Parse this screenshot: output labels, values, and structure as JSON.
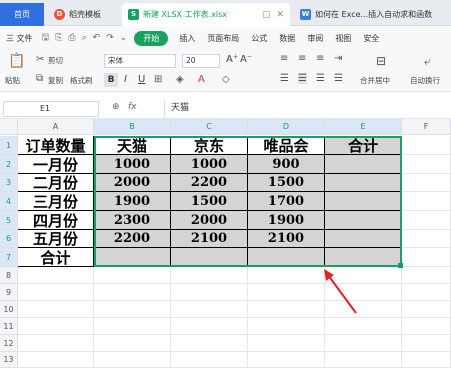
{
  "tabs": [
    {
      "label": "首页"
    },
    {
      "label": "稻壳模板",
      "icon": "daoke-icon"
    },
    {
      "label": "新建 XLSX 工作表.xlsx",
      "icon": "spreadsheet-icon"
    },
    {
      "label": "如何在 Exce...插入自动求和函数",
      "icon": "doc-icon"
    }
  ],
  "menu": {
    "file": "三 文件",
    "start": "开始",
    "items": [
      "插入",
      "页面布局",
      "公式",
      "数据",
      "审阅",
      "视图",
      "安全"
    ]
  },
  "ribbon": {
    "paste": "粘贴",
    "cut": "剪切",
    "copy": "复制",
    "format_painter": "格式刷",
    "font_name": "宋体",
    "font_size": "20",
    "bold": "B",
    "italic": "I",
    "underline": "U",
    "merge_center": "合并居中",
    "auto_wrap": "自动换行"
  },
  "formula_bar": {
    "name_box": "E1",
    "fx": "fx",
    "value": "天猫"
  },
  "columns": [
    "A",
    "B",
    "C",
    "D",
    "E",
    "F"
  ],
  "rows": [
    "1",
    "2",
    "3",
    "4",
    "5",
    "6",
    "7",
    "8",
    "9",
    "10",
    "11",
    "12",
    "13"
  ],
  "table": {
    "header": [
      "订单数量",
      "天猫",
      "京东",
      "唯品会",
      "合计"
    ],
    "rows": [
      [
        "一月份",
        "1000",
        "1000",
        "900",
        ""
      ],
      [
        "二月份",
        "2000",
        "2200",
        "1500",
        ""
      ],
      [
        "三月份",
        "1900",
        "1500",
        "1700",
        ""
      ],
      [
        "四月份",
        "2300",
        "2000",
        "1900",
        ""
      ],
      [
        "五月份",
        "2200",
        "2100",
        "2100",
        ""
      ],
      [
        "合计",
        "",
        "",
        "",
        ""
      ]
    ]
  },
  "colors": {
    "accent": "#19a15f",
    "selection_fill": "#d4d4d4",
    "arrow": "#e02424"
  }
}
